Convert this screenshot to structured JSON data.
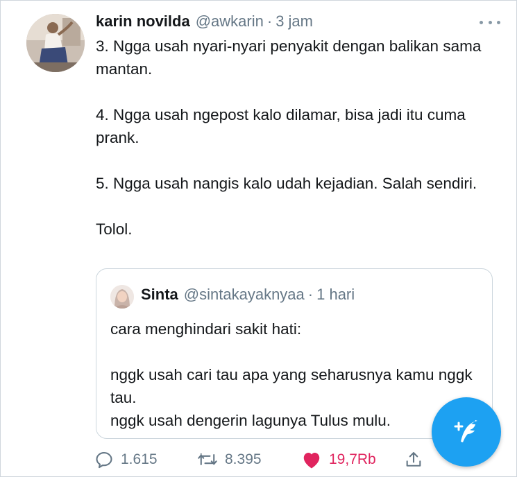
{
  "tweet": {
    "author_name": "karin novilda",
    "author_handle": "@awkarin",
    "separator": "·",
    "time": "3 jam",
    "paragraphs": [
      "3. Ngga usah nyari-nyari penyakit dengan balikan sama mantan.",
      "4. Ngga usah ngepost kalo dilamar, bisa jadi itu cuma prank.",
      "5. Ngga usah nangis kalo udah kejadian. Salah sendiri.",
      "Tolol."
    ]
  },
  "quote": {
    "author_name": "Sinta",
    "author_handle": "@sintakayaknyaa",
    "separator": "·",
    "time": "1 hari",
    "paragraphs": [
      "cara menghindari sakit hati:",
      "nggk usah cari tau apa yang seharusnya kamu nggk tau.\nnggk usah dengerin lagunya Tulus mulu."
    ]
  },
  "actions": {
    "reply_count": "1.615",
    "retweet_count": "8.395",
    "like_count": "19,7Rb"
  },
  "icons": {
    "more": "more-dots-icon",
    "reply": "reply-icon",
    "retweet": "retweet-icon",
    "like": "heart-icon",
    "share": "share-icon",
    "compose": "compose-tweet-icon"
  },
  "colors": {
    "accent": "#1da1f2",
    "like": "#e0245e",
    "secondary_text": "#657786"
  }
}
